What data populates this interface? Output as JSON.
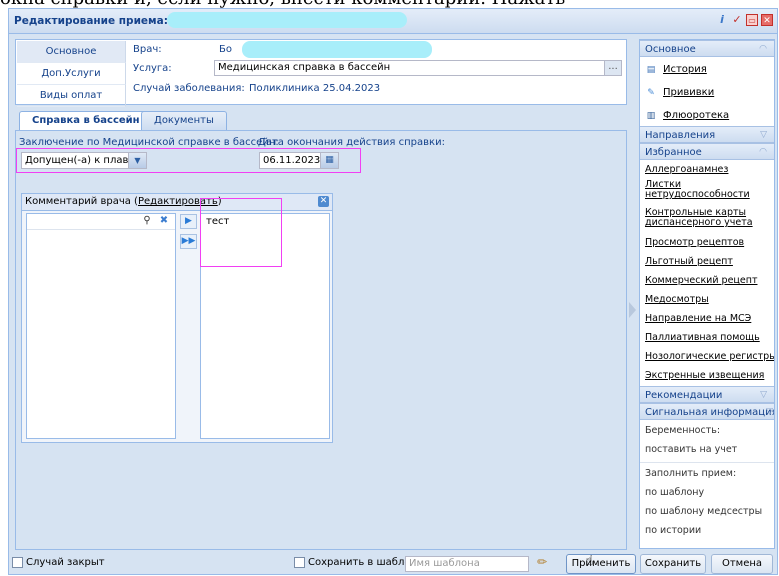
{
  "window": {
    "title": "Редактирование приема: Д"
  },
  "header": {
    "tabs": [
      "Основное",
      "Доп.Услуги",
      "Виды оплат"
    ],
    "doctor_label": "Врач:",
    "doctor_value": "Бо",
    "service_label": "Услуга:",
    "service_value": "Медицинская справка в бассейн",
    "case_label": "Случай заболевания:",
    "case_value": "Поликлиника 25.04.2023"
  },
  "content_tabs": [
    "Справка в бассейн",
    "Документы"
  ],
  "form": {
    "conclusion_label": "Заключение по Медицинской справке в бассейн:",
    "conclusion_value": "Допущен(-а) к плав",
    "end_date_label": "Дата окончания действия справки:",
    "end_date_value": "06.11.2023",
    "comment_label": "Комментарий врача (",
    "comment_edit_link": "Редактировать",
    "comment_label_end": ")",
    "comment_items": [
      "тест"
    ]
  },
  "sidebar": {
    "main_header": "Основное",
    "main_links": [
      "История",
      "Прививки",
      "Флюоротека"
    ],
    "directions_header": "Направления",
    "favorites_header": "Избранное",
    "favorite_links": [
      "Аллергоанамнез",
      "Листки нетрудоспособности",
      "Контрольные карты диспансерного учета",
      "Просмотр рецептов",
      "Льготный рецепт",
      "Коммерческий рецепт",
      "Медосмотры",
      "Направление на МСЭ",
      "Паллиативная помощь",
      "Нозологические регистры",
      "Экстренные извещения"
    ],
    "recommendations_header": "Рекомендации",
    "signal_header": "Сигнальная информация",
    "pregnancy_label": "Беременность:",
    "pregnancy_link": "поставить на учет",
    "fill_label": "Заполнить прием:",
    "fill_links": [
      "по шаблону",
      "по шаблону медсестры",
      "по истории"
    ]
  },
  "bottom": {
    "case_closed_label": "Случай закрыт",
    "save_template_label": "Сохранить в шаблон:",
    "template_placeholder": "Имя шаблона",
    "apply_label": "Применить",
    "save_label": "Сохранить",
    "cancel_label": "Отмена"
  }
}
